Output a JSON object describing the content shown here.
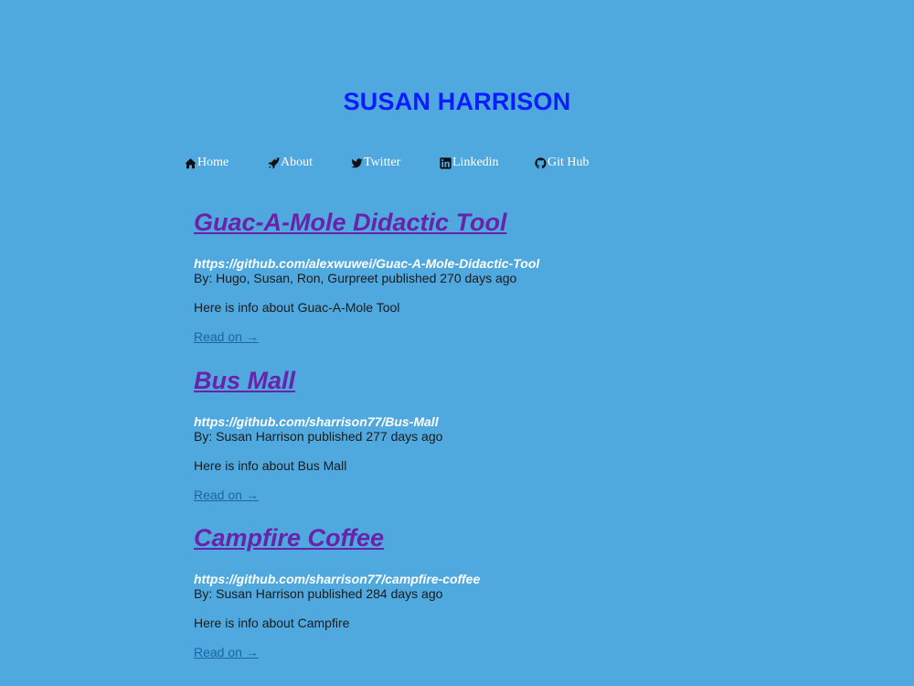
{
  "header": {
    "title": "SUSAN HARRISON"
  },
  "nav": {
    "items": [
      {
        "label": "Home",
        "icon": "home-icon"
      },
      {
        "label": "About",
        "icon": "rocket-icon"
      },
      {
        "label": "Twitter",
        "icon": "twitter-icon"
      },
      {
        "label": "Linkedin",
        "icon": "linkedin-icon"
      },
      {
        "label": "Git  Hub",
        "icon": "github-icon"
      }
    ]
  },
  "posts": [
    {
      "title": "Guac-A-Mole Didactic Tool",
      "url": "https://github.com/alexwuwei/Guac-A-Mole-Didactic-Tool",
      "byline": "By: Hugo, Susan, Ron, Gurpreet published 270 days ago",
      "summary": "Here is info about Guac-A-Mole Tool",
      "read_more": "Read on →"
    },
    {
      "title": "Bus Mall",
      "url": "https://github.com/sharrison77/Bus-Mall",
      "byline": "By: Susan Harrison published 277 days ago",
      "summary": "Here is info about Bus Mall",
      "read_more": "Read on →"
    },
    {
      "title": "Campfire Coffee",
      "url": "https://github.com/sharrison77/campfire-coffee",
      "byline": "By: Susan Harrison published 284 days ago",
      "summary": "Here is info about Campfire",
      "read_more": "Read on →"
    }
  ],
  "colors": {
    "background": "#4fa9df",
    "title": "#0d1bff",
    "post_title": "#6a22a8",
    "link": "#1b65a6"
  }
}
